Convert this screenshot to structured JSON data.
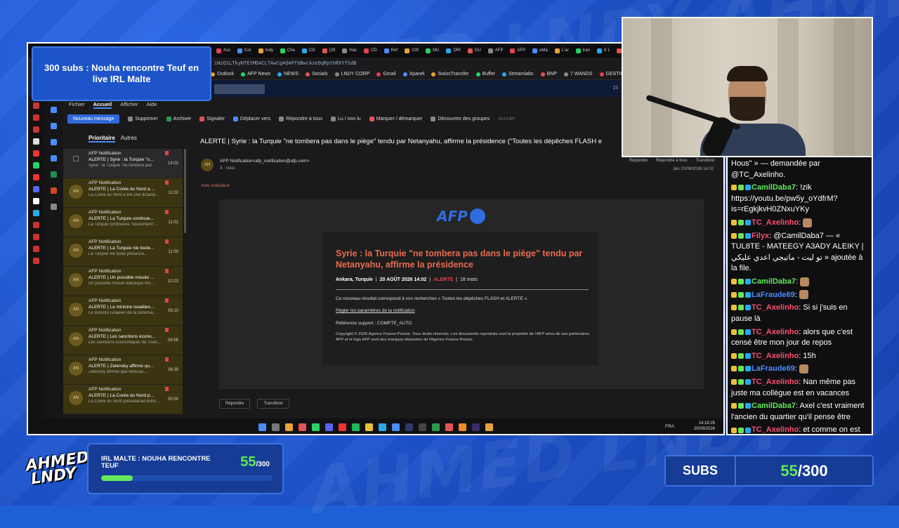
{
  "overlay": {
    "title_card": "300 subs : Nouha rencontre Teuf en live IRL Malte",
    "logo_line1": "AHMED",
    "logo_line2": "LNDY",
    "goal_title": "IRL MALTE : NOUHA RENCONTRE TEUF",
    "goal_current": "55",
    "goal_total": "/300",
    "goal_progress": 0.1833,
    "subs_label": "SUBS",
    "subs_current": "55",
    "subs_total": "/300",
    "accent_color": "#62e85a",
    "panel_color": "#163c96"
  },
  "browser": {
    "tabs": [
      "Ass",
      "Cor",
      "Indy",
      "Che",
      "CD",
      "(29",
      "Hac",
      "CD",
      "Ref",
      "100",
      "MU",
      "DRI",
      "GU",
      "AFP",
      "AFP",
      "eMa",
      "L'ar",
      "Iran",
      "8 1",
      "Er"
    ],
    "address": "iNzQ1LTkyNTEtMDACLTAwCgAQAPfbBwcAzeOqRpthRXYfSdB",
    "bookmarks": [
      "Outlook",
      "AFP News",
      "NEWS",
      "Socials",
      "LNDY CORP",
      "Gmail",
      "Xpanel",
      "SwissTransfer",
      "Buffer",
      "Streamlabs",
      "BNP",
      "7 WANDS",
      "GESTION STREAM"
    ]
  },
  "outlook": {
    "header_count": "15",
    "ribbon_tabs": [
      "Fichier",
      "Accueil",
      "Afficher",
      "Aide"
    ],
    "ribbon": {
      "new_message": "Nouveau message",
      "delete": "Supprimer",
      "archive": "Archiver",
      "report": "Signaler",
      "move": "Déplacer vers",
      "reply_all": "Répondre à tous",
      "read_unread": "Lu / non lu",
      "mark": "Marquer / démarquer",
      "groups": "Découvrez des groupes",
      "cancel": "Annuler"
    },
    "folder_tabs": {
      "priority": "Prioritaire",
      "others": "Autres"
    },
    "messages": [
      {
        "sender": "AFP Notification",
        "subject": "ALERTE | Syrie : la Turquie \"n...",
        "preview": "Syrie : la Turquie \"ne tombera pas",
        "time": "14:02",
        "initials": ""
      },
      {
        "sender": "AFP Notification",
        "subject": "ALERTE | La Corée du Nord a ...",
        "preview": "La Corée du Nord a tiré une dizaine...",
        "time": "11:02",
        "initials": "AN"
      },
      {
        "sender": "AFP Notification",
        "subject": "ALERTE | La Turquie continue...",
        "preview": "La Turquie continuera \"résolument\"...",
        "time": "11:01",
        "initials": "AN"
      },
      {
        "sender": "AFP Notification",
        "subject": "ALERTE | La Turquie nie toute...",
        "preview": "La Turquie nie toute présence...",
        "time": "11:00",
        "initials": "AN"
      },
      {
        "sender": "AFP Notification",
        "subject": "ALERTE | Un possible missile ...",
        "preview": "Un possible missile balistique tiré...",
        "time": "10:23",
        "initials": "AN"
      },
      {
        "sender": "AFP Notification",
        "subject": "ALERTE | Le ministre israélien...",
        "preview": "Le ministre israélien de la Défense...",
        "time": "09:10",
        "initials": "AN"
      },
      {
        "sender": "AFP Notification",
        "subject": "ALERTE | Les sanctions écono...",
        "preview": "Les sanctions économiques de Trum...",
        "time": "08:56",
        "initials": "AN"
      },
      {
        "sender": "AFP Notification",
        "subject": "ALERTE | Zelensky affirme qu...",
        "preview": "Zelensky affirme que Moscou...",
        "time": "08:39",
        "initials": "AN"
      },
      {
        "sender": "AFP Notification",
        "subject": "ALERTE | La Corée du Nord p...",
        "preview": "La Corée du Nord posséderait entre...",
        "time": "05:00",
        "initials": "AN"
      }
    ],
    "reading": {
      "subject": "ALERTE | Syrie : la Turquie \"ne tombera pas dans le piège\" tendu par Netanyahu, affirme la présidence  (\"Toutes les dépêches FLASH e",
      "from": "AFP Notification<afp_notification@afp.com>",
      "to": "À : vous",
      "avatar": "AN",
      "reply": "Répondre",
      "reply_all": "Répondre à tous",
      "forward": "Transférer",
      "date": "Jeu 20/08/2026 14:02",
      "indicator": "Avec indicateur"
    },
    "email": {
      "logo": "AFP",
      "title": "Syrie : la Turquie \"ne tombera pas dans le piège\" tendu par Netanyahu, affirme la présidence",
      "location": "Ankara, Turquie",
      "date": "20 AOÛT 2026 14:02",
      "badge": "ALERTE",
      "words": "18 mots",
      "text": "Ce nouveau résultat correspond à vos recherches « Toutes les dépêches FLASH et ALERTE ».",
      "link": "Régler les paramètres de la notification",
      "reference": "Référence support : COMPTE_AUTO",
      "copyright": "Copyright © 2026 Agence France-Presse. Tous droits réservés. Les documents reproduits sont la propriété de l'AFP et/ou de ses partenaires. AFP et le logo AFP sont des marques déposées de l'Agence France-Presse."
    },
    "bottom_actions": {
      "reply": "Répondre",
      "forward": "Transférer"
    }
  },
  "taskbar": {
    "lang": "FRA",
    "time": "14:18:26",
    "date": "20/08/2026"
  },
  "chat": [
    {
      "user": "",
      "color": "#ffffff",
      "text": "Hous\" » — demandée par @TC_Axelinho."
    },
    {
      "user": "CamilDaba7",
      "color": "#62e85a",
      "text": "!zik https://youtu.be/pw5y_oYdfrM?is=rEgkjkvH0ZNxuYKy"
    },
    {
      "user": "TC_Axelinho",
      "color": "#ff4d6d",
      "text": "",
      "emote": true
    },
    {
      "user": "Filyx",
      "color": "#ff4d6d",
      "text": "@CamilDaba7 — « TUL8TE - MATEEGY A3ADY ALEIKY | تو ليت - ماتيجي اعدي عليكي » ajoutée à la file."
    },
    {
      "user": "CamilDaba7",
      "color": "#62e85a",
      "text": "",
      "emote": true
    },
    {
      "user": "LaFraude69",
      "color": "#4a8df8",
      "text": "",
      "emote": true
    },
    {
      "user": "TC_Axelinho",
      "color": "#ff4d6d",
      "text": "Si si j'suis en pause là"
    },
    {
      "user": "TC_Axelinho",
      "color": "#ff4d6d",
      "text": "alors que c'est censé être mon jour de repos"
    },
    {
      "user": "TC_Axelinho",
      "color": "#ff4d6d",
      "text": "15h"
    },
    {
      "user": "LaFraude69",
      "color": "#4a8df8",
      "text": "",
      "emote": true
    },
    {
      "user": "TC_Axelinho",
      "color": "#ff4d6d",
      "text": "Nan même pas juste ma collègue est en vacances"
    },
    {
      "user": "CamilDaba7",
      "color": "#62e85a",
      "text": "Axel c'est vraiment l'ancien du quartier qu'il pense être"
    },
    {
      "user": "TC_Axelinho",
      "color": "#ff4d6d",
      "text": "et comme on est que deux"
    }
  ]
}
